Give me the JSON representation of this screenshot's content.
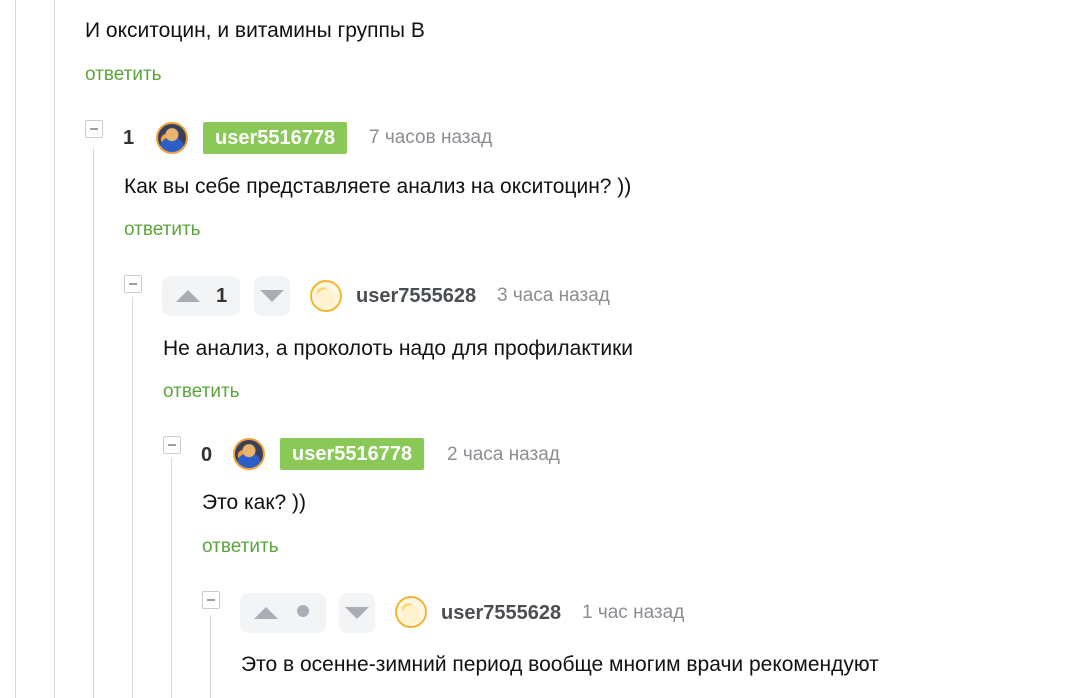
{
  "comments": [
    {
      "text": "И окситоцин, и витамины группы В",
      "reply_label": "ответить"
    },
    {
      "rating": "1",
      "username": "user5516778",
      "time": "7 часов назад",
      "text": "Как вы себе представляете анализ  на окситоцин? ))",
      "reply_label": "ответить",
      "avatar_icon": "avatar-user5516778-icon"
    },
    {
      "rating": "1",
      "username": "user7555628",
      "time": "3 часа назад",
      "text": "Не анализ, а проколоть надо для профилактики",
      "reply_label": "ответить",
      "avatar_icon": "avatar-user7555628-icon"
    },
    {
      "rating": "0",
      "username": "user5516778",
      "time": "2 часа назад",
      "text": "Это как? ))",
      "reply_label": "ответить",
      "avatar_icon": "avatar-user5516778-icon"
    },
    {
      "username": "user7555628",
      "time": "1 час назад",
      "text": "Это в осенне-зимний период вообще многим врачи рекомендуют",
      "avatar_icon": "avatar-user7555628-icon"
    }
  ],
  "colors": {
    "reply_link": "#5ca43c",
    "author_badge": "#8ac858",
    "thread_line": "#d7d9de",
    "muted_text": "#8a8d92"
  }
}
